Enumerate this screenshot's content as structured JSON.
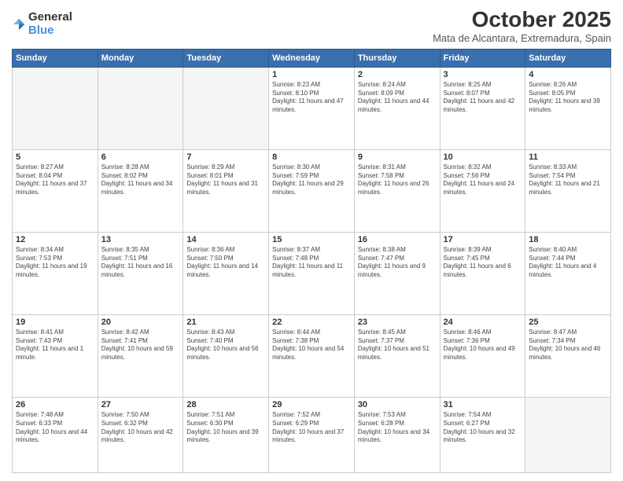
{
  "logo": {
    "general": "General",
    "blue": "Blue"
  },
  "title": "October 2025",
  "subtitle": "Mata de Alcantara, Extremadura, Spain",
  "days_of_week": [
    "Sunday",
    "Monday",
    "Tuesday",
    "Wednesday",
    "Thursday",
    "Friday",
    "Saturday"
  ],
  "weeks": [
    [
      {
        "day": "",
        "info": ""
      },
      {
        "day": "",
        "info": ""
      },
      {
        "day": "",
        "info": ""
      },
      {
        "day": "1",
        "info": "Sunrise: 8:23 AM\nSunset: 8:10 PM\nDaylight: 11 hours and 47 minutes."
      },
      {
        "day": "2",
        "info": "Sunrise: 8:24 AM\nSunset: 8:09 PM\nDaylight: 11 hours and 44 minutes."
      },
      {
        "day": "3",
        "info": "Sunrise: 8:25 AM\nSunset: 8:07 PM\nDaylight: 11 hours and 42 minutes."
      },
      {
        "day": "4",
        "info": "Sunrise: 8:26 AM\nSunset: 8:05 PM\nDaylight: 11 hours and 39 minutes."
      }
    ],
    [
      {
        "day": "5",
        "info": "Sunrise: 8:27 AM\nSunset: 8:04 PM\nDaylight: 11 hours and 37 minutes."
      },
      {
        "day": "6",
        "info": "Sunrise: 8:28 AM\nSunset: 8:02 PM\nDaylight: 11 hours and 34 minutes."
      },
      {
        "day": "7",
        "info": "Sunrise: 8:29 AM\nSunset: 8:01 PM\nDaylight: 11 hours and 31 minutes."
      },
      {
        "day": "8",
        "info": "Sunrise: 8:30 AM\nSunset: 7:59 PM\nDaylight: 11 hours and 29 minutes."
      },
      {
        "day": "9",
        "info": "Sunrise: 8:31 AM\nSunset: 7:58 PM\nDaylight: 11 hours and 26 minutes."
      },
      {
        "day": "10",
        "info": "Sunrise: 8:32 AM\nSunset: 7:56 PM\nDaylight: 11 hours and 24 minutes."
      },
      {
        "day": "11",
        "info": "Sunrise: 8:33 AM\nSunset: 7:54 PM\nDaylight: 11 hours and 21 minutes."
      }
    ],
    [
      {
        "day": "12",
        "info": "Sunrise: 8:34 AM\nSunset: 7:53 PM\nDaylight: 11 hours and 19 minutes."
      },
      {
        "day": "13",
        "info": "Sunrise: 8:35 AM\nSunset: 7:51 PM\nDaylight: 11 hours and 16 minutes."
      },
      {
        "day": "14",
        "info": "Sunrise: 8:36 AM\nSunset: 7:50 PM\nDaylight: 11 hours and 14 minutes."
      },
      {
        "day": "15",
        "info": "Sunrise: 8:37 AM\nSunset: 7:48 PM\nDaylight: 11 hours and 11 minutes."
      },
      {
        "day": "16",
        "info": "Sunrise: 8:38 AM\nSunset: 7:47 PM\nDaylight: 11 hours and 9 minutes."
      },
      {
        "day": "17",
        "info": "Sunrise: 8:39 AM\nSunset: 7:45 PM\nDaylight: 11 hours and 6 minutes."
      },
      {
        "day": "18",
        "info": "Sunrise: 8:40 AM\nSunset: 7:44 PM\nDaylight: 11 hours and 4 minutes."
      }
    ],
    [
      {
        "day": "19",
        "info": "Sunrise: 8:41 AM\nSunset: 7:43 PM\nDaylight: 11 hours and 1 minute."
      },
      {
        "day": "20",
        "info": "Sunrise: 8:42 AM\nSunset: 7:41 PM\nDaylight: 10 hours and 59 minutes."
      },
      {
        "day": "21",
        "info": "Sunrise: 8:43 AM\nSunset: 7:40 PM\nDaylight: 10 hours and 56 minutes."
      },
      {
        "day": "22",
        "info": "Sunrise: 8:44 AM\nSunset: 7:38 PM\nDaylight: 10 hours and 54 minutes."
      },
      {
        "day": "23",
        "info": "Sunrise: 8:45 AM\nSunset: 7:37 PM\nDaylight: 10 hours and 51 minutes."
      },
      {
        "day": "24",
        "info": "Sunrise: 8:46 AM\nSunset: 7:36 PM\nDaylight: 10 hours and 49 minutes."
      },
      {
        "day": "25",
        "info": "Sunrise: 8:47 AM\nSunset: 7:34 PM\nDaylight: 10 hours and 46 minutes."
      }
    ],
    [
      {
        "day": "26",
        "info": "Sunrise: 7:48 AM\nSunset: 6:33 PM\nDaylight: 10 hours and 44 minutes."
      },
      {
        "day": "27",
        "info": "Sunrise: 7:50 AM\nSunset: 6:32 PM\nDaylight: 10 hours and 42 minutes."
      },
      {
        "day": "28",
        "info": "Sunrise: 7:51 AM\nSunset: 6:30 PM\nDaylight: 10 hours and 39 minutes."
      },
      {
        "day": "29",
        "info": "Sunrise: 7:52 AM\nSunset: 6:29 PM\nDaylight: 10 hours and 37 minutes."
      },
      {
        "day": "30",
        "info": "Sunrise: 7:53 AM\nSunset: 6:28 PM\nDaylight: 10 hours and 34 minutes."
      },
      {
        "day": "31",
        "info": "Sunrise: 7:54 AM\nSunset: 6:27 PM\nDaylight: 10 hours and 32 minutes."
      },
      {
        "day": "",
        "info": ""
      }
    ]
  ]
}
